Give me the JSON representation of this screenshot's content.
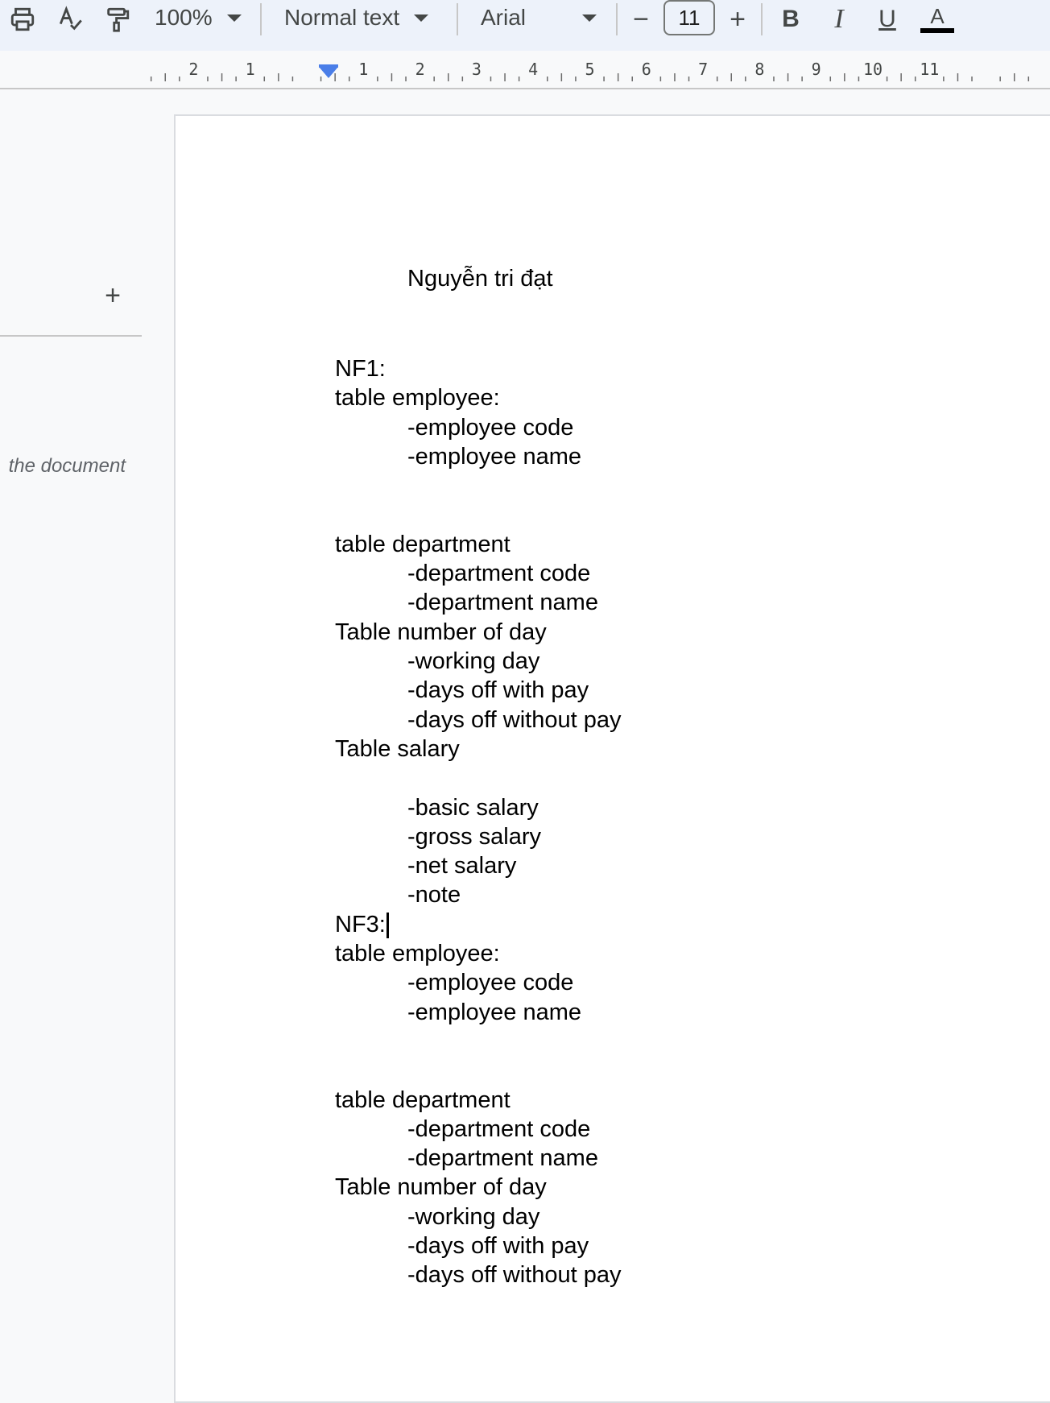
{
  "toolbar": {
    "zoom": "100%",
    "style": "Normal text",
    "font": "Arial",
    "font_size": "11",
    "bold": "B",
    "italic": "I",
    "underline": "U",
    "text_color": "A",
    "decrease": "−",
    "increase": "+"
  },
  "ruler": {
    "left_labels": [
      "2",
      "1"
    ],
    "right_labels": [
      "1",
      "2",
      "3",
      "4",
      "5",
      "6",
      "7",
      "8",
      "9",
      "10",
      "11"
    ]
  },
  "sidebar": {
    "add_tab": "+",
    "hint": "the document"
  },
  "document": {
    "title": "Nguyễn tri đạt",
    "lines": [
      {
        "text": "NF1:",
        "indent": false
      },
      {
        "text": "table employee:",
        "indent": false
      },
      {
        "text": "-employee code",
        "indent": true
      },
      {
        "text": "-employee name",
        "indent": true
      },
      {
        "text": "",
        "indent": false
      },
      {
        "text": "",
        "indent": false
      },
      {
        "text": "table department",
        "indent": false
      },
      {
        "text": "-department code",
        "indent": true
      },
      {
        "text": "-department name",
        "indent": true
      },
      {
        "text": "Table number of day",
        "indent": false
      },
      {
        "text": "-working day",
        "indent": true
      },
      {
        "text": "-days off with pay",
        "indent": true
      },
      {
        "text": "-days off without pay",
        "indent": true
      },
      {
        "text": "Table salary",
        "indent": false
      },
      {
        "text": "",
        "indent": false
      },
      {
        "text": "-basic salary",
        "indent": true
      },
      {
        "text": "-gross salary",
        "indent": true
      },
      {
        "text": "-net salary",
        "indent": true
      },
      {
        "text": "-note",
        "indent": true
      },
      {
        "text": "NF3:",
        "indent": false,
        "cursor": true
      },
      {
        "text": "table employee:",
        "indent": false
      },
      {
        "text": "-employee code",
        "indent": true
      },
      {
        "text": "-employee name",
        "indent": true
      },
      {
        "text": "",
        "indent": false
      },
      {
        "text": "",
        "indent": false
      },
      {
        "text": "table department",
        "indent": false
      },
      {
        "text": "-department code",
        "indent": true
      },
      {
        "text": "-department name",
        "indent": true
      },
      {
        "text": "Table number of day",
        "indent": false
      },
      {
        "text": "-working day",
        "indent": true
      },
      {
        "text": "-days off with pay",
        "indent": true
      },
      {
        "text": "-days off without pay",
        "indent": true
      }
    ]
  },
  "colors": {
    "toolbar_bg": "#edf2fa",
    "page_bg": "#ffffff",
    "canvas_bg": "#f8f9fa",
    "indent_marker": "#4a7ee8",
    "text_color_bar": "#000000"
  }
}
